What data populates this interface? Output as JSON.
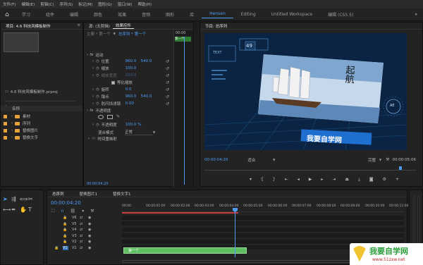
{
  "menu": [
    "文件(F)",
    "编辑(E)",
    "剪辑(C)",
    "序列(S)",
    "标记(M)",
    "图形(G)",
    "窗口(W)",
    "帮助(H)"
  ],
  "workspaces": [
    "学习",
    "组件",
    "编辑",
    "颜色",
    "效果",
    "音频",
    "图形",
    "库",
    "Hensen",
    "Editing",
    "Untitled Workspace",
    "编辑 (CS5.5)"
  ],
  "workspace_active": "Hensen",
  "project": {
    "title": "项目: 4.6 科技风模板制作",
    "file": "4.6 科技风模板制作.prproj",
    "col_name": "名称",
    "items": [
      "素材",
      "序列",
      "替换图片",
      "替换文字"
    ]
  },
  "effects": {
    "tabs": [
      "源: (无剪辑)",
      "效果控件"
    ],
    "master": "主要 * 第一个",
    "clip": "总序列 * 第一个",
    "timecode_top": "00:00",
    "clip_badge": "第一个",
    "motion": "运动",
    "rows": [
      {
        "label": "位置",
        "v1": "960.0",
        "v2": "540.0"
      },
      {
        "label": "缩放",
        "v1": "100.0",
        "v2": ""
      },
      {
        "label": "缩放宽度",
        "v1": "100.0",
        "v2": ""
      },
      {
        "label": "等比缩放",
        "v1": "",
        "v2": ""
      },
      {
        "label": "旋转",
        "v1": "0.0",
        "v2": ""
      },
      {
        "label": "锚点",
        "v1": "960.0",
        "v2": "540.0"
      },
      {
        "label": "防闪烁滤镜",
        "v1": "0.00",
        "v2": ""
      }
    ],
    "opacity": "不透明度",
    "opacity_row": {
      "label": "不透明度",
      "value": "100.0 %"
    },
    "blend_label": "混合模式",
    "blend_value": "正常",
    "remap": "时间重映射",
    "timecode_bottom": "00:00:04:20"
  },
  "program": {
    "title": "节目: 总序列",
    "timecode": "00:00:04:20",
    "fit": "适合",
    "quality": "完整",
    "duration": "00:00:05:06",
    "hud_number": "49",
    "hud_text": "TEXT",
    "calligraphy": "起航",
    "caption": "我要自学网",
    "badge": "AE"
  },
  "timeline": {
    "tabs": [
      "总序列",
      "替换图片1",
      "替换文字1"
    ],
    "timecode": "00:00:04:20",
    "ruler": [
      "00:00",
      "00:00:01:00",
      "00:00:02:00",
      "00:00:03:00",
      "00:00:04:00",
      "00:00:05:00",
      "00:00:06:00",
      "00:00:07:00",
      "00:00:08:00",
      "00:00:09:00",
      "00:00:10:00",
      "00:00:11:00"
    ],
    "tracks": [
      "V6",
      "V5",
      "V4",
      "V3",
      "V2",
      "V1"
    ],
    "clip_label": "第一个",
    "playhead_fraction": 0.4
  },
  "watermark": {
    "text": "我要自学网",
    "url": "www.51zxw.net"
  }
}
